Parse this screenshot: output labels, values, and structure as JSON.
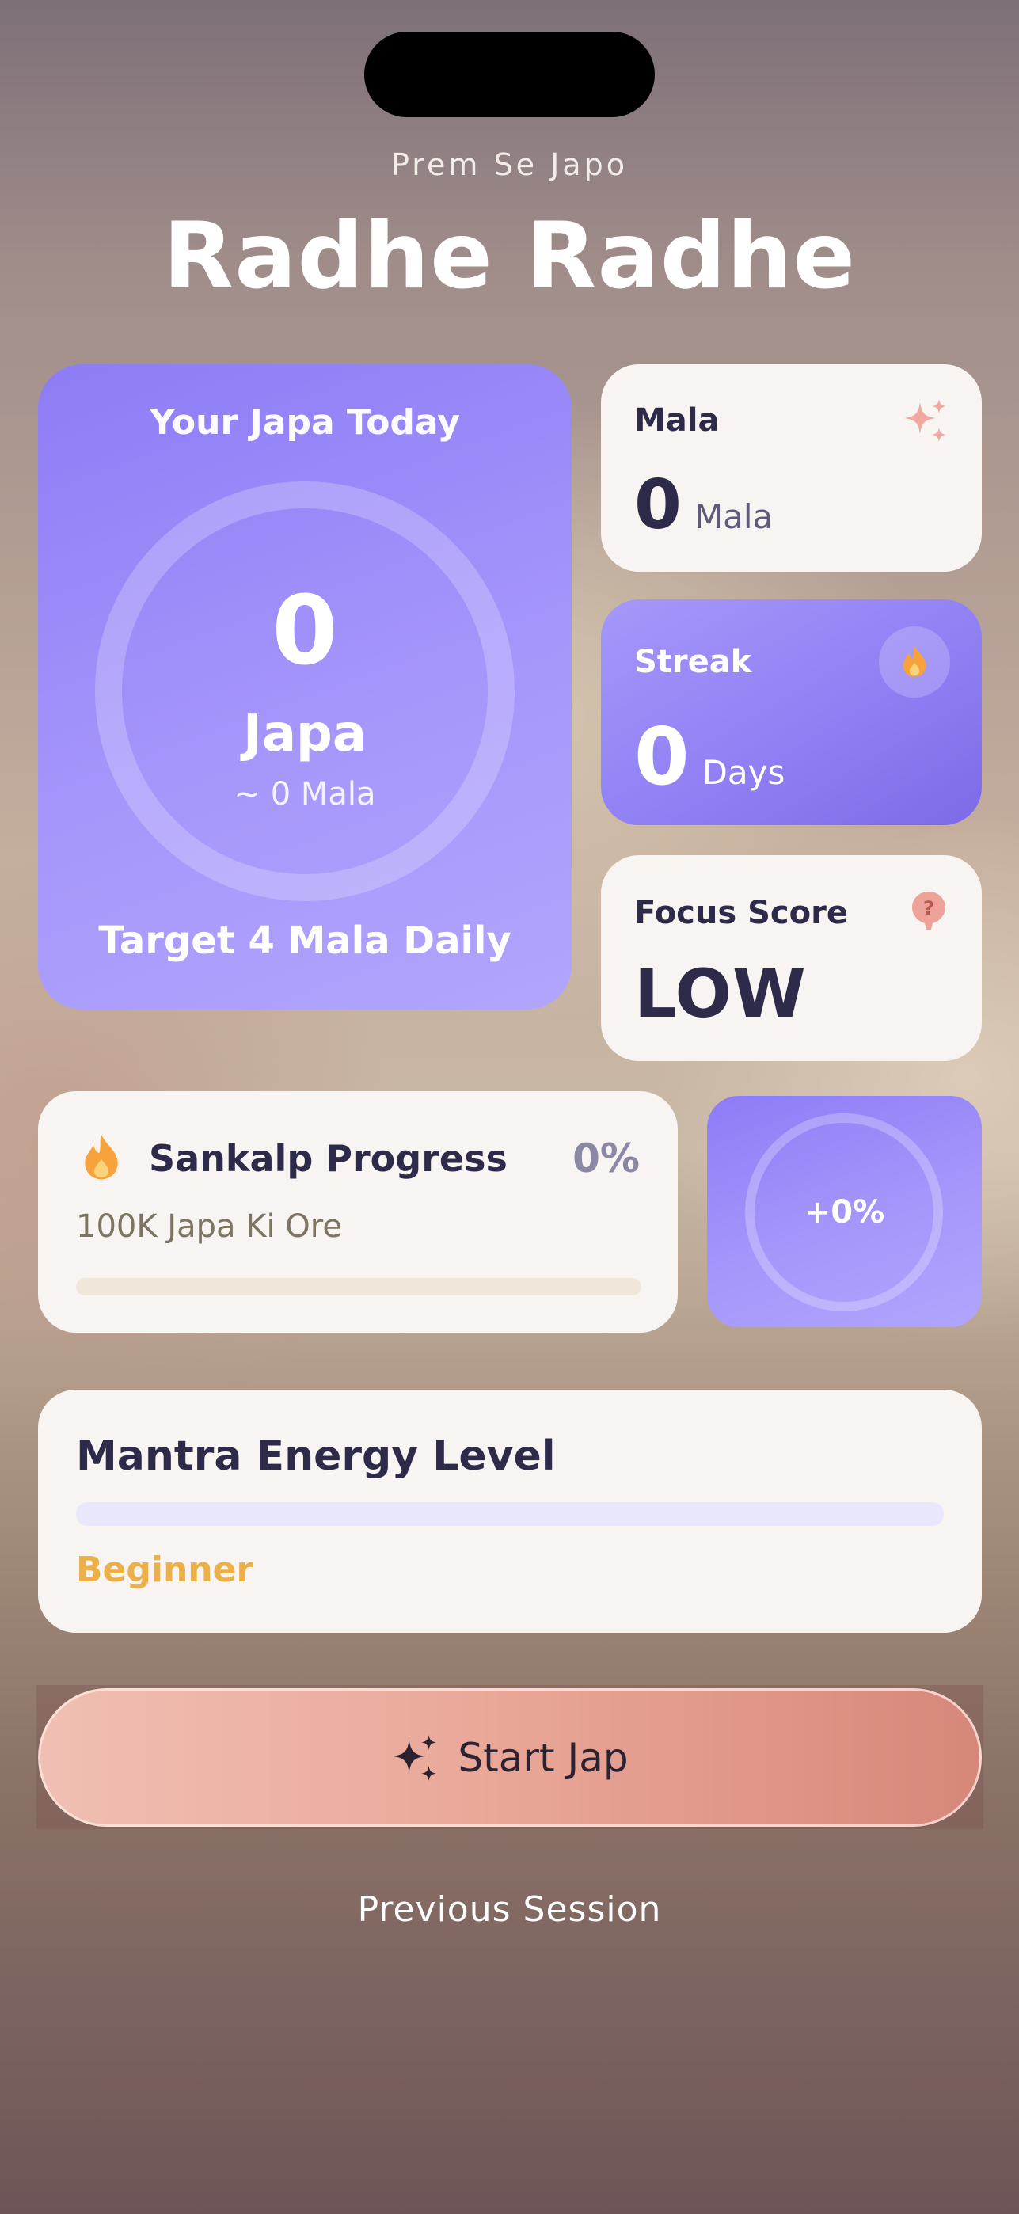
{
  "header": {
    "kicker": "Prem Se Japo",
    "title": "Radhe Radhe"
  },
  "japa_card": {
    "heading": "Your Japa Today",
    "count": "0",
    "unit": "Japa",
    "approx": "~ 0 Mala",
    "target": "Target 4 Mala Daily",
    "progress_fraction": 0
  },
  "mala_card": {
    "label": "Mala",
    "value": "0",
    "unit": "Mala",
    "icon": "sparkle-icon"
  },
  "streak_card": {
    "label": "Streak",
    "value": "0",
    "unit": "Days",
    "icon": "flame-icon"
  },
  "focus_card": {
    "label": "Focus Score",
    "value": "LOW",
    "icon": "help-icon"
  },
  "sankalp": {
    "title": "Sankalp Progress",
    "percent": "0%",
    "subtitle": "100K Japa Ki Ore",
    "progress_fraction": 0,
    "icon": "flame-icon"
  },
  "delta": {
    "value": "+0%"
  },
  "energy": {
    "title": "Mantra Energy Level",
    "level": "Beginner",
    "progress_fraction": 0
  },
  "actions": {
    "start": "Start Jap",
    "previous": "Previous Session"
  },
  "colors": {
    "accent_purple": "#8d7cf6",
    "flame_orange": "#f3a53a",
    "level_gold": "#ecb049",
    "start_button": "#e9a697"
  }
}
